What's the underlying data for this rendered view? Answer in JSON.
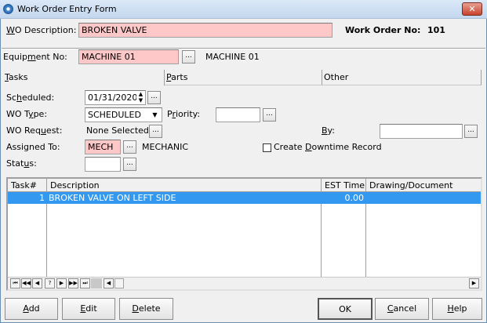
{
  "window": {
    "title": "Work Order Entry Form",
    "close_glyph": "✕"
  },
  "header": {
    "wo_description_label": "WO Description:",
    "wo_description_value": "BROKEN VALVE",
    "work_order_no_label": "Work Order  No:",
    "work_order_no_value": "101"
  },
  "equipment": {
    "label": "Equipment No:",
    "value": "MACHINE 01",
    "name": "MACHINE 01"
  },
  "tabs": [
    {
      "label": "Tasks",
      "key": 0
    },
    {
      "label": "Parts",
      "key": 0
    },
    {
      "label": "Other",
      "key": 1
    }
  ],
  "form": {
    "scheduled_label": "Scheduled:",
    "scheduled_value": "01/31/2020",
    "wo_type_label": "WO Type:",
    "wo_type_value": "SCHEDULED",
    "priority_label": "Priority:",
    "priority_value": "",
    "wo_request_label": "WO Request:",
    "wo_request_value": "None Selected",
    "by_label": "By:",
    "by_value": "",
    "assigned_label": "Assigned To:",
    "assigned_value": "MECH",
    "assigned_name": "MECHANIC",
    "downtime_label": "Create Downtime Record",
    "downtime_checked": false,
    "status_label": "Status:",
    "status_value": ""
  },
  "grid": {
    "columns": [
      "Task#",
      "Description",
      "EST Time",
      "Drawing/Document"
    ],
    "rows": [
      {
        "task": "1",
        "description": "BROKEN VALVE ON LEFT SIDE",
        "est_time": "0.00",
        "drawing": ""
      }
    ],
    "nav": [
      "⏮",
      "◀◀",
      "◀",
      "?",
      "▶",
      "▶▶",
      "⏭"
    ]
  },
  "buttons": {
    "add": "Add",
    "edit": "Edit",
    "delete": "Delete",
    "ok": "OK",
    "cancel": "Cancel",
    "help": "Help",
    "ellipsis": "..."
  },
  "colors": {
    "selection": "#3399f0",
    "required_field": "#ffc8c8"
  }
}
